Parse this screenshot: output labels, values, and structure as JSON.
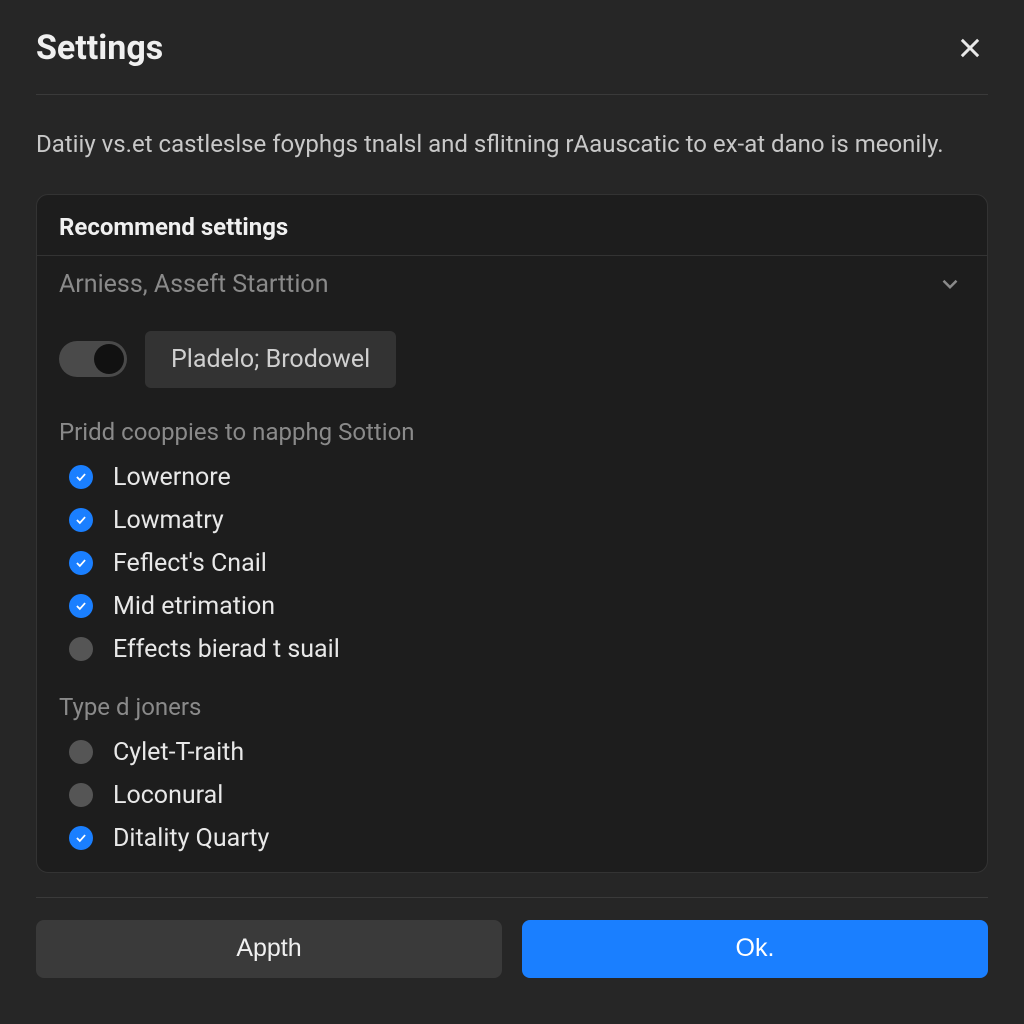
{
  "header": {
    "title": "Settings"
  },
  "description": "Datiiy vs.et castleslse foyphgs tnalsl and sflitning rAauscatic to ex-at dano is meonily.",
  "panel": {
    "title": "Recommend settings",
    "dropdown": {
      "label": "Arniess, Asseft Starttion"
    },
    "toggle": {
      "chip": "Pladelo; Brodowel"
    },
    "group1": {
      "label": "Pridd cooppies to napphg Sottion",
      "items": [
        {
          "label": "Lowernore",
          "checked": true
        },
        {
          "label": "Lowmatry",
          "checked": true
        },
        {
          "label": "Feflect's Cnail",
          "checked": true
        },
        {
          "label": "Mid etrimation",
          "checked": true
        },
        {
          "label": "Effects bierad t suail",
          "checked": false
        }
      ]
    },
    "group2": {
      "label": "Type d joners",
      "items": [
        {
          "label": "Cylet-T-raith",
          "checked": false
        },
        {
          "label": "Loconural",
          "checked": false
        },
        {
          "label": "Ditality Quarty",
          "checked": true
        }
      ]
    }
  },
  "footer": {
    "apply": "Appth",
    "ok": "Ok."
  }
}
